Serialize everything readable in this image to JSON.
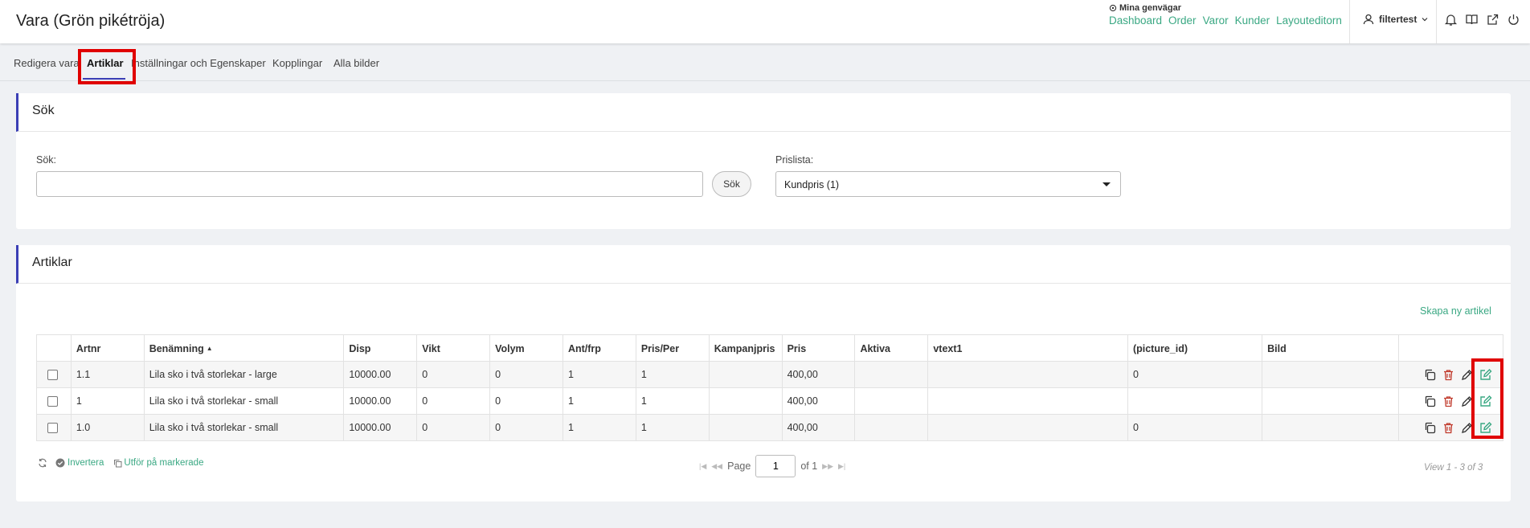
{
  "header": {
    "title": "Vara (Grön pikétröja)",
    "shortcuts_title": "Mina genvägar",
    "shortcuts": [
      "Dashboard",
      "Order",
      "Varor",
      "Kunder",
      "Layouteditorn"
    ],
    "user": "filtertest"
  },
  "tabs": [
    "Redigera vara",
    "Artiklar",
    "Inställningar och Egenskaper",
    "Kopplingar",
    "Alla bilder"
  ],
  "search_card": {
    "title": "Sök",
    "search_label": "Sök:",
    "search_value": "",
    "search_button": "Sök",
    "pricelist_label": "Prislista:",
    "pricelist_value": "Kundpris (1)"
  },
  "articles_card": {
    "title": "Artiklar",
    "create_link": "Skapa ny artikel",
    "columns": [
      "Artnr",
      "Benämning",
      "Disp",
      "Vikt",
      "Volym",
      "Ant/frp",
      "Pris/Per",
      "Kampanjpris",
      "Pris",
      "Aktiva",
      "vtext1",
      "(picture_id)",
      "Bild"
    ],
    "rows": [
      [
        "1.1",
        "Lila sko i två storlekar - large",
        "10000.00",
        "0",
        "0",
        "1",
        "1",
        "",
        "400,00",
        "",
        "",
        "0",
        ""
      ],
      [
        "1",
        "Lila sko i två storlekar - small",
        "10000.00",
        "0",
        "0",
        "1",
        "1",
        "",
        "400,00",
        "",
        "",
        "",
        ""
      ],
      [
        "1.0",
        "Lila sko i två storlekar - small",
        "10000.00",
        "0",
        "0",
        "1",
        "1",
        "",
        "400,00",
        "",
        "",
        "0",
        ""
      ]
    ],
    "footer": {
      "invert_label": "Invertera",
      "bulk_label": "Utför på markerade",
      "page_label": "Page",
      "page_value": "1",
      "of_label": "of 1",
      "view_info": "View 1 - 3 of 3"
    }
  },
  "colors": {
    "accent": "#3aa883",
    "brand": "#3b3fb5",
    "highlight": "#e00000",
    "delete": "#c0392b"
  }
}
